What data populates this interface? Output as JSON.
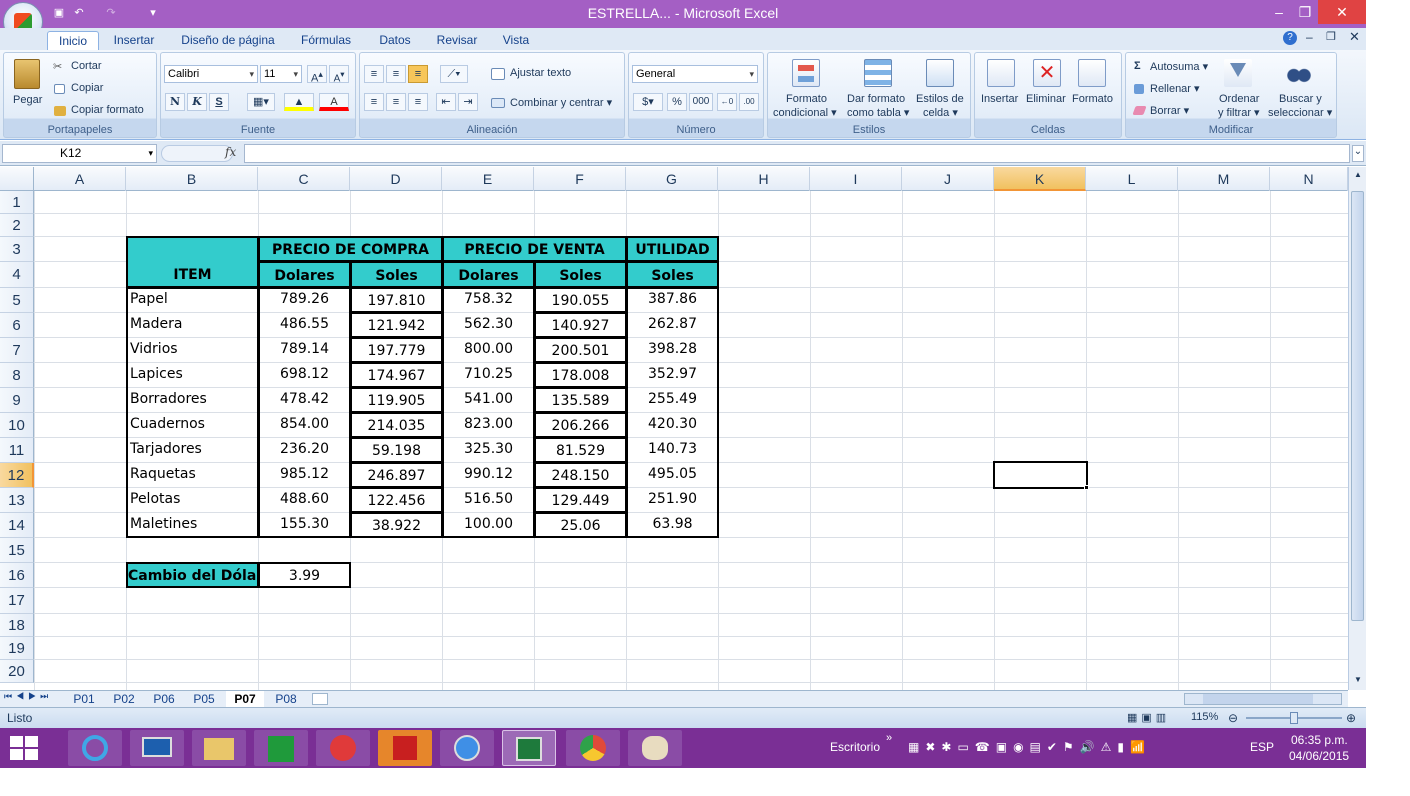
{
  "window": {
    "title": "ESTRELLA... - Microsoft Excel"
  },
  "ribbon_tabs": [
    "Inicio",
    "Insertar",
    "Diseño de página",
    "Fórmulas",
    "Datos",
    "Revisar",
    "Vista"
  ],
  "clipboard": {
    "paste": "Pegar",
    "cut": "Cortar",
    "copy": "Copiar",
    "format_painter": "Copiar formato",
    "label": "Portapapeles"
  },
  "font": {
    "name": "Calibri",
    "size": "11",
    "label": "Fuente",
    "bold": "N",
    "italic": "K",
    "underline": "S"
  },
  "alignment": {
    "wrap": "Ajustar texto",
    "merge": "Combinar y centrar",
    "label": "Alineación"
  },
  "number": {
    "format": "General",
    "percent": "%",
    "thousands": "000",
    "label": "Número"
  },
  "styles": {
    "cond1": "Formato",
    "cond2": "condicional",
    "table1": "Dar formato",
    "table2": "como tabla",
    "cell1": "Estilos de",
    "cell2": "celda",
    "label": "Estilos"
  },
  "cells": {
    "insert": "Insertar",
    "delete": "Eliminar",
    "format": "Formato",
    "label": "Celdas"
  },
  "editing": {
    "autosum": "Autosuma",
    "fill": "Rellenar",
    "clear": "Borrar",
    "sort1": "Ordenar",
    "sort2": "y filtrar",
    "find1": "Buscar y",
    "find2": "seleccionar",
    "label": "Modificar"
  },
  "formula_bar": {
    "name_box": "K12",
    "fx": "fx",
    "value": ""
  },
  "columns": [
    "A",
    "B",
    "C",
    "D",
    "E",
    "F",
    "G",
    "H",
    "I",
    "J",
    "K",
    "L",
    "M",
    "N"
  ],
  "rows": [
    "1",
    "2",
    "3",
    "4",
    "5",
    "6",
    "7",
    "8",
    "9",
    "10",
    "11",
    "12",
    "13",
    "14",
    "15",
    "16",
    "17",
    "18",
    "19",
    "20"
  ],
  "table": {
    "header_item": "ITEM",
    "header_compra": "PRECIO DE COMPRA",
    "header_venta": "PRECIO DE VENTA",
    "header_utilidad": "UTILIDAD",
    "sub_dolares": "Dolares",
    "sub_soles": "Soles",
    "rows": [
      [
        "Papel",
        "789.26",
        "197.810",
        "758.32",
        "190.055",
        "387.86"
      ],
      [
        "Madera",
        "486.55",
        "121.942",
        "562.30",
        "140.927",
        "262.87"
      ],
      [
        "Vidrios",
        "789.14",
        "197.779",
        "800.00",
        "200.501",
        "398.28"
      ],
      [
        "Lapices",
        "698.12",
        "174.967",
        "710.25",
        "178.008",
        "352.97"
      ],
      [
        "Borradores",
        "478.42",
        "119.905",
        "541.00",
        "135.589",
        "255.49"
      ],
      [
        "Cuadernos",
        "854.00",
        "214.035",
        "823.00",
        "206.266",
        "420.30"
      ],
      [
        "Tarjadores",
        "236.20",
        "59.198",
        "325.30",
        "81.529",
        "140.73"
      ],
      [
        "Raquetas",
        "985.12",
        "246.897",
        "990.12",
        "248.150",
        "495.05"
      ],
      [
        "Pelotas",
        "488.60",
        "122.456",
        "516.50",
        "129.449",
        "251.90"
      ],
      [
        "Maletines",
        "155.30",
        "38.922",
        "100.00",
        "25.06",
        "63.98"
      ]
    ],
    "exchange_label": "Cambio del Dólar",
    "exchange_value": "3.99"
  },
  "sheets": [
    "P01",
    "P02",
    "P06",
    "P05",
    "P07",
    "P08"
  ],
  "active_sheet": "P07",
  "status": {
    "ready": "Listo",
    "zoom": "115%"
  },
  "taskbar": {
    "desktop": "Escritorio",
    "lang": "ESP",
    "time": "06:35 p.m.",
    "date": "04/06/2015"
  },
  "colors": {
    "header_fill": "#33cccc",
    "titlebar": "#a45fc4",
    "taskbar": "#7a2f95"
  }
}
